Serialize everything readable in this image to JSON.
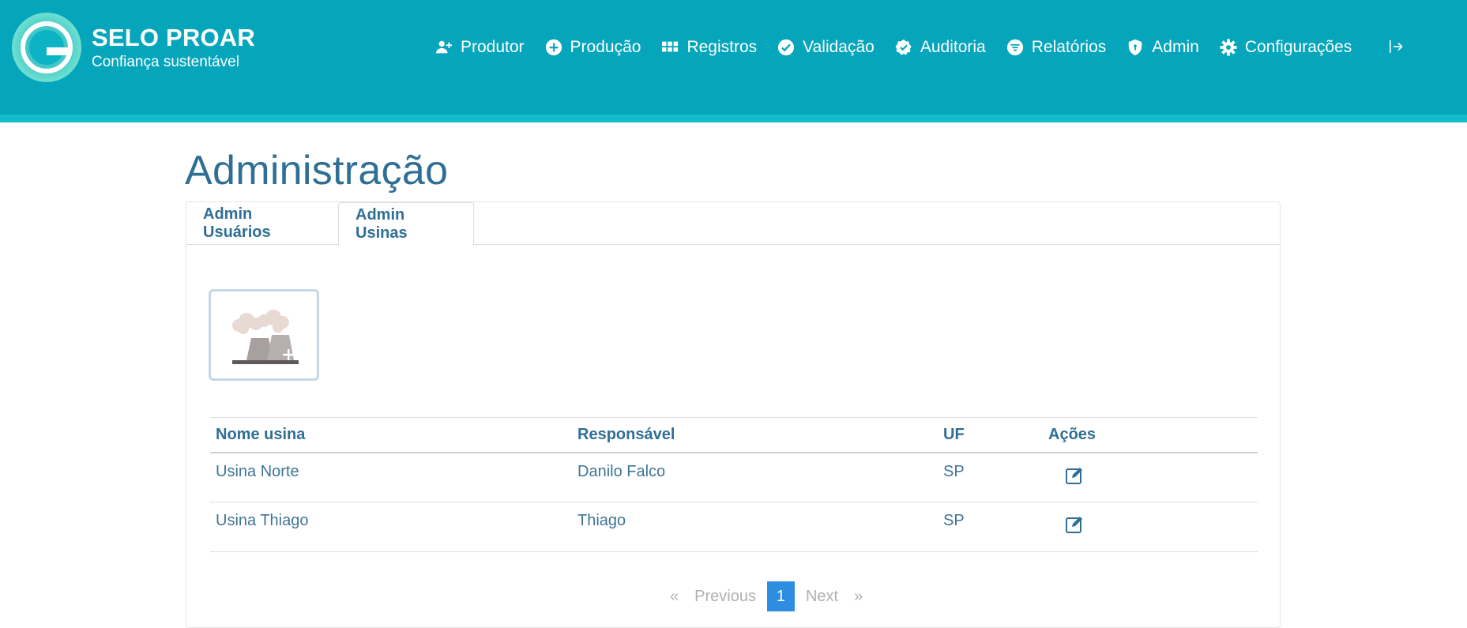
{
  "brand": {
    "title": "SELO PROAR",
    "subtitle": "Confiança sustentável"
  },
  "nav": {
    "items": [
      {
        "label": "Produtor",
        "icon": "user-plus-icon"
      },
      {
        "label": "Produção",
        "icon": "plus-circle-icon"
      },
      {
        "label": "Registros",
        "icon": "grid-icon"
      },
      {
        "label": "Validação",
        "icon": "check-circle-icon"
      },
      {
        "label": "Auditoria",
        "icon": "badge-check-icon"
      },
      {
        "label": "Relatórios",
        "icon": "filter-circle-icon"
      },
      {
        "label": "Admin",
        "icon": "shield-icon"
      },
      {
        "label": "Configurações",
        "icon": "gear-icon"
      }
    ],
    "logout_icon": "logout-icon"
  },
  "page": {
    "title": "Administração"
  },
  "tabs": [
    {
      "label": "Admin Usuários",
      "active": false
    },
    {
      "label": "Admin Usinas",
      "active": true
    }
  ],
  "add_plant": {
    "icon": "power-plant-add-icon"
  },
  "table": {
    "headers": [
      "Nome usina",
      "Responsável",
      "UF",
      "Ações"
    ],
    "rows": [
      {
        "name": "Usina Norte",
        "responsible": "Danilo Falco",
        "uf": "SP",
        "action_icon": "edit-icon"
      },
      {
        "name": "Usina Thiago",
        "responsible": "Thiago",
        "uf": "SP",
        "action_icon": "edit-icon"
      }
    ]
  },
  "pagination": {
    "first": "«",
    "previous": "Previous",
    "current": "1",
    "next": "Next",
    "last": "»"
  },
  "colors": {
    "header": "#05a6bb",
    "stripe": "#14bccb",
    "text": "#2f6f96",
    "pager_active": "#2d8de0"
  }
}
